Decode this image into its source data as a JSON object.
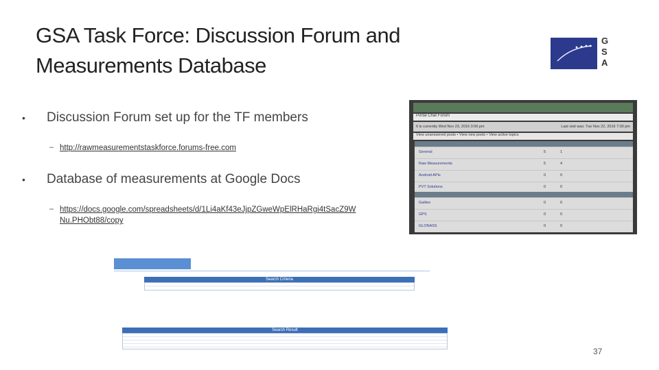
{
  "slide": {
    "title_line1": "GSA Task Force: Discussion Forum and",
    "title_line2": "Measurements Database",
    "logo_letters": [
      "G",
      "S",
      "A"
    ],
    "bullets": [
      {
        "symbol": "•",
        "text": "Discussion Forum set up for the TF members",
        "sub_dash": "–",
        "sub_link": "http://rawmeasurementstaskforce.forums-free.com"
      },
      {
        "symbol": "•",
        "text": "Database of measurements at Google Docs",
        "sub_dash": "–",
        "sub_link_line1": "https://docs.google.com/spreadsheets/d/1Li4aKf43eJjpZGweWpElRHaRgi4tSacZ9W",
        "sub_link_line2": "Nu.PHObt88/copy"
      }
    ],
    "page_number": "37"
  },
  "forum_screenshot": {
    "nav": "Portal   Chat   Forum",
    "bar": "User Control Panel (0 new messages) • View your posts",
    "info_left": "It is currently Wed Nov 23, 2016 3:06 pm",
    "info_right": "Last visit was: Tue Nov 22, 2016 7:00 pm",
    "links": "View unanswered posts • View new posts • View active topics",
    "forums": [
      {
        "name": "General",
        "topics": "5",
        "posts": "1"
      },
      {
        "name": "Raw Measurements",
        "topics": "5",
        "posts": "4"
      },
      {
        "name": "Android APIs",
        "topics": "0",
        "posts": "0"
      },
      {
        "name": "PVT Solutions",
        "topics": "0",
        "posts": "0"
      }
    ],
    "constellations": [
      {
        "name": "Galileo",
        "topics": "0",
        "posts": "0"
      },
      {
        "name": "GPS",
        "topics": "0",
        "posts": "0"
      },
      {
        "name": "GLONASS",
        "topics": "0",
        "posts": "0"
      }
    ]
  },
  "db_screenshot": {
    "criteria_label": "Search Criteria",
    "result_label": "Search Result"
  }
}
